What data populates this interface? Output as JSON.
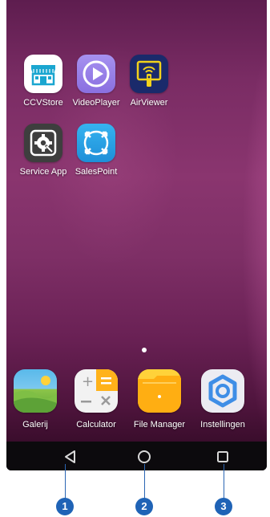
{
  "home_apps": [
    {
      "name": "ccvstore",
      "label": "CCVStore"
    },
    {
      "name": "videoplayer",
      "label": "VideoPlayer"
    },
    {
      "name": "airviewer",
      "label": "AirViewer"
    },
    {
      "name": "service-app",
      "label": "Service App"
    },
    {
      "name": "salespoint",
      "label": "SalesPoint"
    }
  ],
  "dock_apps": [
    {
      "name": "galerij",
      "label": "Galerij"
    },
    {
      "name": "calculator",
      "label": "Calculator"
    },
    {
      "name": "file-manager",
      "label": "File Manager"
    },
    {
      "name": "instellingen",
      "label": "Instellingen"
    }
  ],
  "nav_buttons": [
    {
      "name": "back",
      "icon": "back-triangle-icon"
    },
    {
      "name": "home",
      "icon": "home-circle-icon"
    },
    {
      "name": "recents",
      "icon": "recents-square-icon"
    }
  ],
  "callouts": [
    "1",
    "2",
    "3"
  ],
  "colors": {
    "wallpaper": "#7a2c64",
    "navbar": "#0c0a0d",
    "badge": "#1f63b6",
    "ccvstore": "#ffffff",
    "videoplayer": "#9a80e8",
    "airviewer": "#1a2a6b",
    "service_app": "#3e3e3e",
    "salespoint": "#2aa0e8",
    "file_manager": "#ffb21a",
    "instellingen": "#ececf2"
  }
}
